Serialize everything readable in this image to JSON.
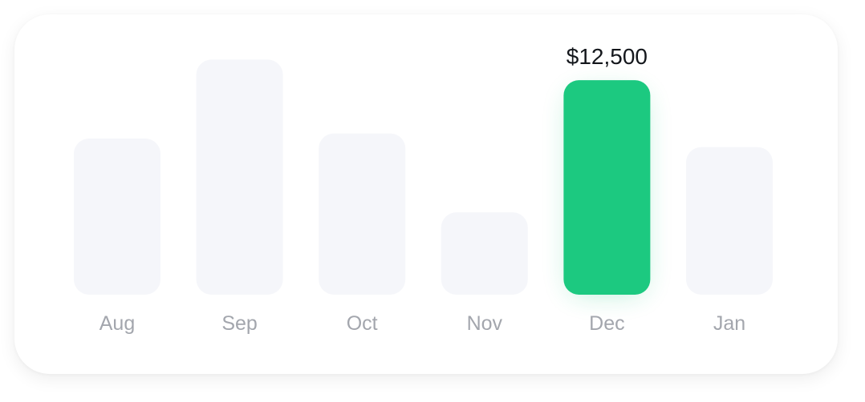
{
  "chart_data": {
    "type": "bar",
    "categories": [
      "Aug",
      "Sep",
      "Oct",
      "Nov",
      "Dec",
      "Jan"
    ],
    "values": [
      9100,
      13700,
      9400,
      4800,
      12500,
      8600
    ],
    "highlighted_index": 4,
    "highlight_label": "$12,500",
    "ylim": [
      0,
      14000
    ],
    "grid": false,
    "colors": {
      "bar": "#f5f6fa",
      "highlight": "#1cc980",
      "label": "#a3a6ad",
      "value_label": "#14171c"
    }
  }
}
